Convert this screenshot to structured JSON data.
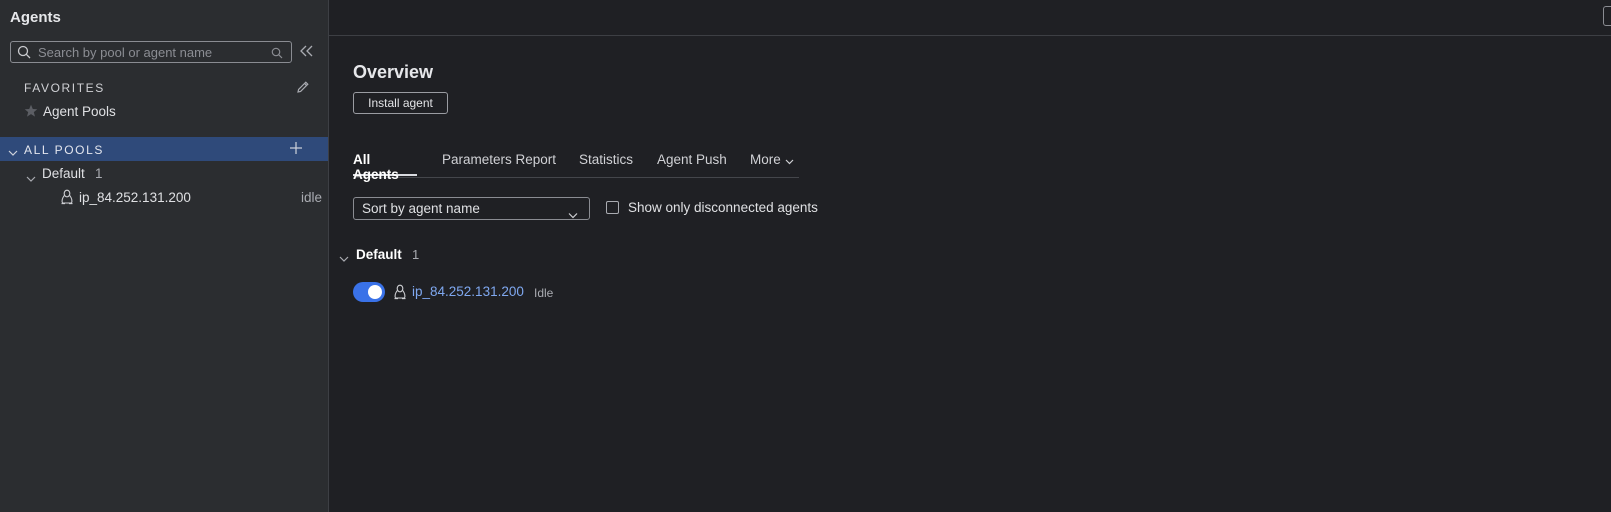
{
  "sidebar": {
    "title": "Agents",
    "search": {
      "placeholder": "Search by pool or agent name",
      "value": ""
    },
    "favorites": {
      "heading": "FAVORITES",
      "items": [
        {
          "label": "Agent Pools",
          "icon": "star-icon"
        }
      ]
    },
    "all_pools": {
      "heading": "ALL POOLS",
      "pools": [
        {
          "name": "Default",
          "count": "1",
          "agents": [
            {
              "name": "ip_84.252.131.200",
              "status": "idle",
              "os_icon": "linux-icon"
            }
          ]
        }
      ]
    }
  },
  "main": {
    "title": "Overview",
    "install_button": "Install agent",
    "tabs": [
      {
        "label": "All Agents",
        "active": true
      },
      {
        "label": "Parameters Report",
        "active": false
      },
      {
        "label": "Statistics",
        "active": false
      },
      {
        "label": "Agent Push",
        "active": false
      },
      {
        "label": "More",
        "active": false
      }
    ],
    "sort": {
      "selected": "Sort by agent name"
    },
    "filter_checkbox": {
      "label": "Show only disconnected agents",
      "checked": false
    },
    "groups": [
      {
        "name": "Default",
        "count": "1",
        "agents": [
          {
            "name": "ip_84.252.131.200",
            "status": "Idle",
            "enabled": true
          }
        ]
      }
    ]
  },
  "colors": {
    "accent": "#3a72e8",
    "link": "#7fa8f0",
    "selection": "#2f4a7a",
    "background": "#1f2024",
    "sidebar": "#2b2d30"
  }
}
